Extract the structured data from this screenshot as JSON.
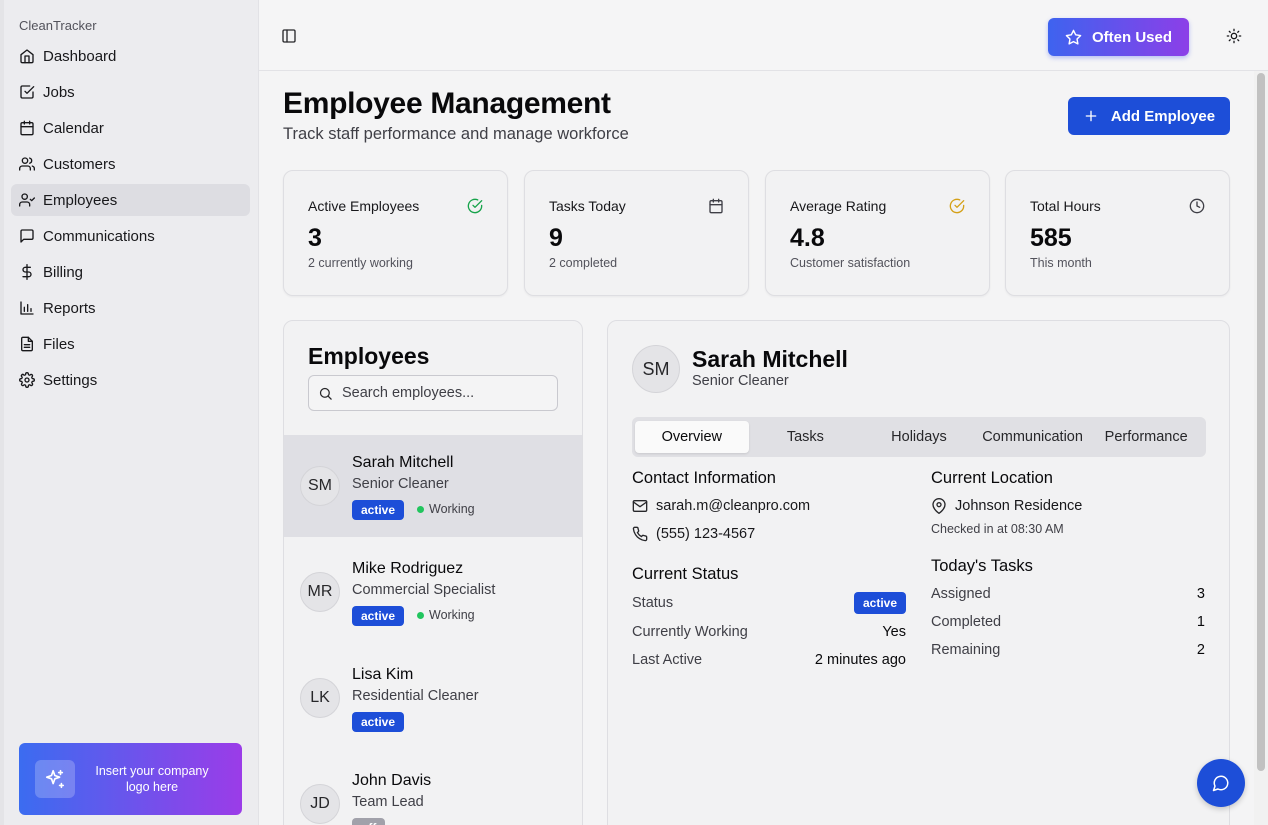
{
  "app": {
    "name": "CleanTracker"
  },
  "sidebar": {
    "items": [
      {
        "label": "Dashboard",
        "icon": "home-icon"
      },
      {
        "label": "Jobs",
        "icon": "check-square-icon"
      },
      {
        "label": "Calendar",
        "icon": "calendar-icon"
      },
      {
        "label": "Customers",
        "icon": "users-icon"
      },
      {
        "label": "Employees",
        "icon": "user-check-icon",
        "active": true
      },
      {
        "label": "Communications",
        "icon": "message-square-icon"
      },
      {
        "label": "Billing",
        "icon": "dollar-icon"
      },
      {
        "label": "Reports",
        "icon": "bar-chart-icon"
      },
      {
        "label": "Files",
        "icon": "file-icon"
      },
      {
        "label": "Settings",
        "icon": "gear-icon"
      }
    ],
    "logo_text": "Insert your company logo here"
  },
  "topbar": {
    "often_used_label": "Often Used"
  },
  "page": {
    "title": "Employee Management",
    "subtitle": "Track staff performance and manage workforce",
    "add_label": "Add Employee"
  },
  "stats": [
    {
      "label": "Active Employees",
      "value": "3",
      "note": "2 currently working",
      "icon": "check-circle-icon",
      "color": "#16a34a"
    },
    {
      "label": "Tasks Today",
      "value": "9",
      "note": "2 completed",
      "icon": "calendar-icon",
      "color": "#3f3f46"
    },
    {
      "label": "Average Rating",
      "value": "4.8",
      "note": "Customer satisfaction",
      "icon": "check-circle-icon",
      "color": "#d4a017"
    },
    {
      "label": "Total Hours",
      "value": "585",
      "note": "This month",
      "icon": "clock-icon",
      "color": "#3f3f46"
    }
  ],
  "employees": {
    "title": "Employees",
    "search_placeholder": "Search employees...",
    "list": [
      {
        "initials": "SM",
        "name": "Sarah Mitchell",
        "role": "Senior Cleaner",
        "status": "active",
        "working": "Working"
      },
      {
        "initials": "MR",
        "name": "Mike Rodriguez",
        "role": "Commercial Specialist",
        "status": "active",
        "working": "Working"
      },
      {
        "initials": "LK",
        "name": "Lisa Kim",
        "role": "Residential Cleaner",
        "status": "active"
      },
      {
        "initials": "JD",
        "name": "John Davis",
        "role": "Team Lead",
        "status": "off"
      }
    ]
  },
  "detail": {
    "initials": "SM",
    "name": "Sarah Mitchell",
    "role": "Senior Cleaner",
    "tabs": [
      "Overview",
      "Tasks",
      "Holidays",
      "Communication",
      "Performance"
    ],
    "contact": {
      "title": "Contact Information",
      "email": "sarah.m@cleanpro.com",
      "phone": "(555) 123-4567"
    },
    "current_status": {
      "title": "Current Status",
      "status_label": "Status",
      "status_value": "active",
      "working_label": "Currently Working",
      "working_value": "Yes",
      "last_active_label": "Last Active",
      "last_active_value": "2 minutes ago"
    },
    "location": {
      "title": "Current Location",
      "place": "Johnson Residence",
      "checked_in": "Checked in at 08:30 AM"
    },
    "tasks": {
      "title": "Today's Tasks",
      "assigned_label": "Assigned",
      "assigned": "3",
      "completed_label": "Completed",
      "completed": "1",
      "remaining_label": "Remaining",
      "remaining": "2"
    }
  }
}
